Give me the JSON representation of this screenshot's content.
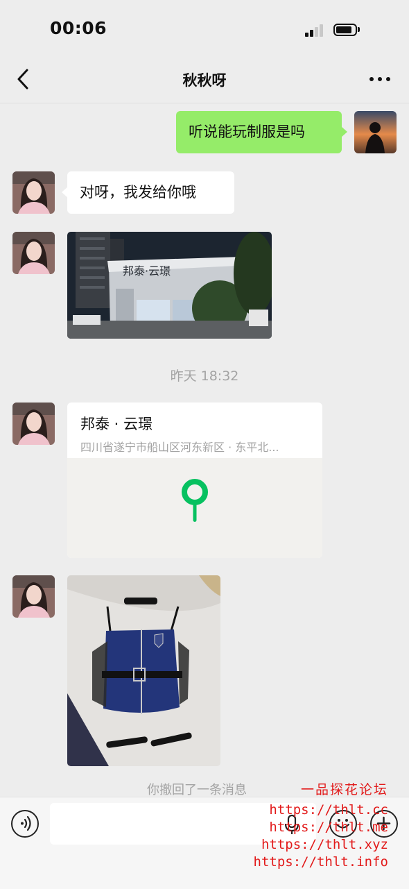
{
  "status_bar": {
    "time": "00:06"
  },
  "nav": {
    "title": "秋秋呀"
  },
  "messages": {
    "m1_text": "听说能玩制服是吗",
    "m2_text": "对呀，我发给你哦",
    "timestamp": "昨天 18:32",
    "location": {
      "title": "邦泰 · 云璟",
      "address": "四川省遂宁市船山区河东新区 · 东平北..."
    },
    "building_sign": "邦泰·云璟",
    "recall_notice": "你撤回了一条消息"
  },
  "input_bar": {
    "placeholder": ""
  },
  "watermark": {
    "title": "一品探花论坛",
    "urls": [
      "https://thlt.cc",
      "https://thlt.me",
      "https://thlt.xyz",
      "https://thlt.info"
    ]
  },
  "colors": {
    "outgoing_bubble": "#95ec69",
    "incoming_bubble": "#ffffff",
    "map_pin": "#07c160",
    "watermark": "#e21b1b"
  },
  "icons": [
    "back-arrow",
    "more-dots",
    "voice",
    "microphone",
    "emoji",
    "add",
    "map-pin"
  ]
}
